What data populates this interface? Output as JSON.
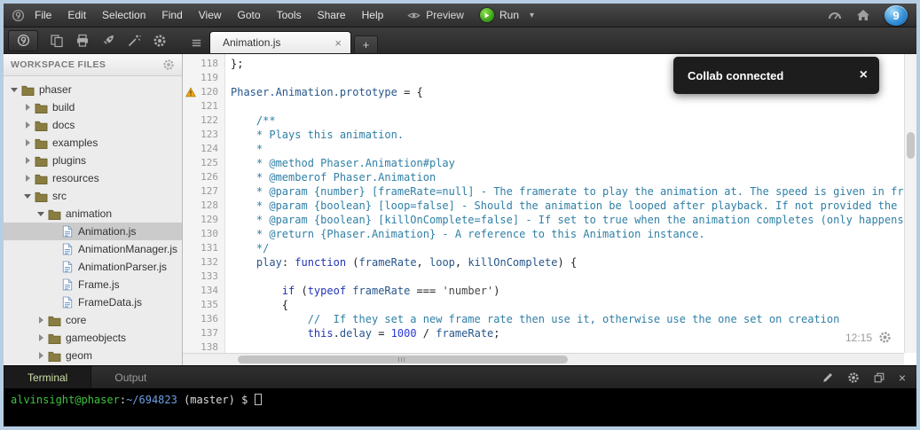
{
  "menubar": {
    "items": [
      "File",
      "Edit",
      "Selection",
      "Find",
      "View",
      "Goto",
      "Tools",
      "Share",
      "Help"
    ],
    "preview_label": "Preview",
    "run_label": "Run",
    "run_caret": "▾",
    "logo_text": "9"
  },
  "tabs": {
    "open": [
      {
        "label": "Animation.js",
        "active": true
      }
    ],
    "close_glyph": "×",
    "new_glyph": "+"
  },
  "sidebar": {
    "header": "WORKSPACE FILES",
    "tree": [
      {
        "label": "phaser",
        "type": "folder",
        "level": 0,
        "expanded": true
      },
      {
        "label": "build",
        "type": "folder",
        "level": 1,
        "expanded": false
      },
      {
        "label": "docs",
        "type": "folder",
        "level": 1,
        "expanded": false
      },
      {
        "label": "examples",
        "type": "folder",
        "level": 1,
        "expanded": false
      },
      {
        "label": "plugins",
        "type": "folder",
        "level": 1,
        "expanded": false
      },
      {
        "label": "resources",
        "type": "folder",
        "level": 1,
        "expanded": false
      },
      {
        "label": "src",
        "type": "folder",
        "level": 1,
        "expanded": true
      },
      {
        "label": "animation",
        "type": "folder",
        "level": 2,
        "expanded": true
      },
      {
        "label": "Animation.js",
        "type": "file",
        "level": 3,
        "selected": true
      },
      {
        "label": "AnimationManager.js",
        "type": "file",
        "level": 3
      },
      {
        "label": "AnimationParser.js",
        "type": "file",
        "level": 3
      },
      {
        "label": "Frame.js",
        "type": "file",
        "level": 3
      },
      {
        "label": "FrameData.js",
        "type": "file",
        "level": 3
      },
      {
        "label": "core",
        "type": "folder",
        "level": 2,
        "expanded": false
      },
      {
        "label": "gameobjects",
        "type": "folder",
        "level": 2,
        "expanded": false
      },
      {
        "label": "geom",
        "type": "folder",
        "level": 2,
        "expanded": false
      }
    ]
  },
  "editor": {
    "status": {
      "position": "12:15"
    },
    "lines": [
      {
        "no": 118,
        "segs": [
          [
            "p",
            "};"
          ]
        ]
      },
      {
        "no": 119,
        "segs": []
      },
      {
        "no": 120,
        "warning": true,
        "segs": [
          [
            "id",
            "Phaser.Animation.prototype"
          ],
          [
            "p",
            " = {"
          ]
        ]
      },
      {
        "no": 121,
        "segs": []
      },
      {
        "no": 122,
        "segs": [
          [
            "c",
            "    /**"
          ]
        ]
      },
      {
        "no": 123,
        "segs": [
          [
            "c",
            "    * Plays this animation."
          ]
        ]
      },
      {
        "no": 124,
        "segs": [
          [
            "c",
            "    *"
          ]
        ]
      },
      {
        "no": 125,
        "segs": [
          [
            "c",
            "    * @method Phaser.Animation#play"
          ]
        ]
      },
      {
        "no": 126,
        "segs": [
          [
            "c",
            "    * @memberof Phaser.Animation"
          ]
        ]
      },
      {
        "no": 127,
        "segs": [
          [
            "c",
            "    * @param {number} [frameRate=null] - The framerate to play the animation at. The speed is given in frame"
          ]
        ]
      },
      {
        "no": 128,
        "segs": [
          [
            "c",
            "    * @param {boolean} [loop=false] - Should the animation be looped after playback. If not provided the pre"
          ]
        ]
      },
      {
        "no": 129,
        "segs": [
          [
            "c",
            "    * @param {boolean} [killOnComplete=false] - If set to true when the animation completes (only happens if"
          ]
        ]
      },
      {
        "no": 130,
        "segs": [
          [
            "c",
            "    * @return {Phaser.Animation} - A reference to this Animation instance."
          ]
        ]
      },
      {
        "no": 131,
        "segs": [
          [
            "c",
            "    */"
          ]
        ]
      },
      {
        "no": 132,
        "segs": [
          [
            "p",
            "    "
          ],
          [
            "id",
            "play"
          ],
          [
            "p",
            ": "
          ],
          [
            "k",
            "function"
          ],
          [
            "p",
            " ("
          ],
          [
            "id",
            "frameRate"
          ],
          [
            "p",
            ", "
          ],
          [
            "id",
            "loop"
          ],
          [
            "p",
            ", "
          ],
          [
            "id",
            "killOnComplete"
          ],
          [
            "p",
            ") {"
          ]
        ]
      },
      {
        "no": 133,
        "segs": []
      },
      {
        "no": 134,
        "segs": [
          [
            "p",
            "        "
          ],
          [
            "k",
            "if"
          ],
          [
            "p",
            " ("
          ],
          [
            "k",
            "typeof"
          ],
          [
            "p",
            " "
          ],
          [
            "id",
            "frameRate"
          ],
          [
            "p",
            " === "
          ],
          [
            "s",
            "'number'"
          ],
          [
            "p",
            ")"
          ]
        ]
      },
      {
        "no": 135,
        "segs": [
          [
            "p",
            "        {"
          ]
        ]
      },
      {
        "no": 136,
        "segs": [
          [
            "c",
            "            //  If they set a new frame rate then use it, otherwise use the one set on creation"
          ]
        ]
      },
      {
        "no": 137,
        "segs": [
          [
            "p",
            "            "
          ],
          [
            "k",
            "this"
          ],
          [
            "p",
            "."
          ],
          [
            "id",
            "delay"
          ],
          [
            "p",
            " = "
          ],
          [
            "n",
            "1000"
          ],
          [
            "p",
            " / "
          ],
          [
            "id",
            "frameRate"
          ],
          [
            "p",
            ";"
          ]
        ]
      },
      {
        "no": 138,
        "segs": []
      }
    ]
  },
  "toast": {
    "message": "Collab connected",
    "close_glyph": "×"
  },
  "console": {
    "tabs": [
      {
        "label": "Terminal",
        "active": true
      },
      {
        "label": "Output",
        "active": false
      }
    ],
    "close_glyph": "×",
    "prompt": [
      {
        "text": "alvinsight@phaser",
        "style": "user"
      },
      {
        "text": ":",
        "style": "plain"
      },
      {
        "text": "~/694823",
        "style": "path"
      },
      {
        "text": " (master) ",
        "style": "plain"
      },
      {
        "text": "$ ",
        "style": "plain"
      }
    ]
  },
  "colors": {
    "run_green": "#3fa51c",
    "toast_bg": "#0c0c0c",
    "comment_teal": "#2f7fa6",
    "terminal_user_green": "#3fc23f",
    "terminal_path_blue": "#6b9fe4",
    "frame_blue": "#b7cde4"
  }
}
